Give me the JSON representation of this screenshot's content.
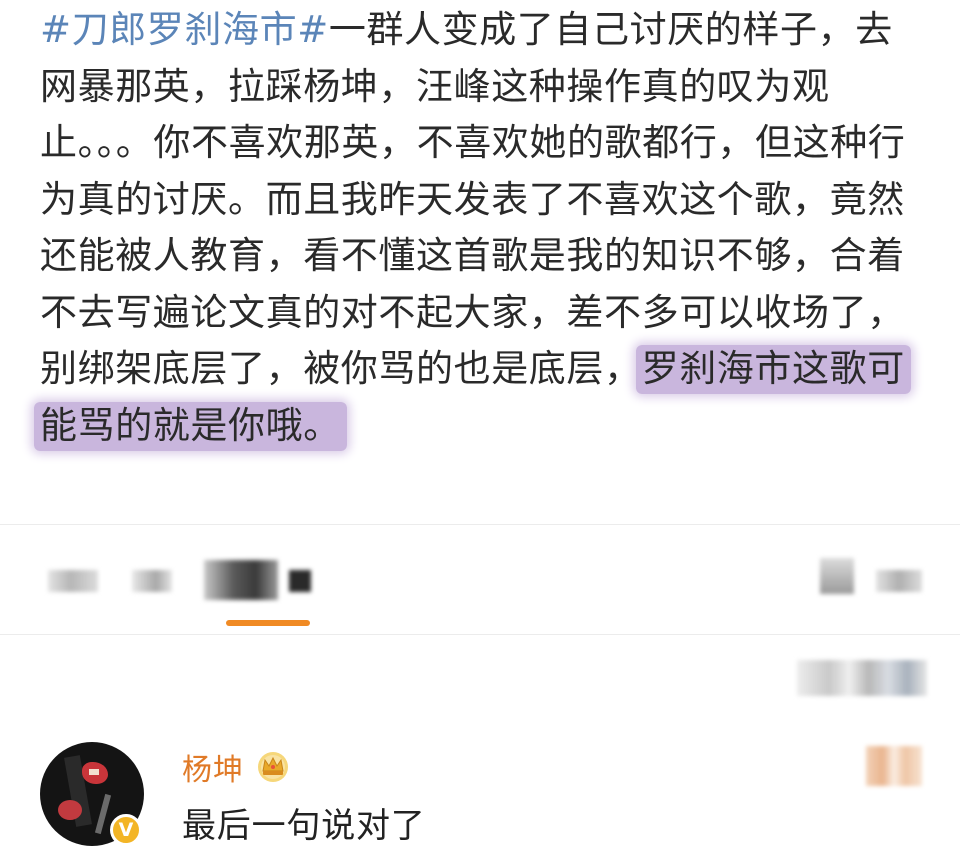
{
  "post": {
    "hashtag": "#刀郎罗刹海市#",
    "body": "一群人变成了自己讨厌的样子，去网暴那英，拉踩杨坤，汪峰这种操作真的叹为观止。。。你不喜欢那英，不喜欢她的歌都行，但这种行为真的讨厌。而且我昨天发表了不喜欢这个歌，竟然还能被人教育，看不懂这首歌是我的知识不够，合着不去写遍论文真的对不起大家，差不多可以收场了，别绑架底层了，被你骂的也是底层，",
    "highlight": "罗刹海市这歌可能骂的就是你哦。"
  },
  "comment": {
    "username": "杨坤",
    "text": "最后一句说对了",
    "badge_icon": "crown-icon",
    "verified_icon": "verified-v-icon",
    "verified_mark": "V"
  },
  "colors": {
    "hashtag": "#5b85b8",
    "highlight": "#c9b6dd",
    "active_tab": "#f08a24",
    "username": "#e07a27",
    "verified": "#f3b526"
  }
}
